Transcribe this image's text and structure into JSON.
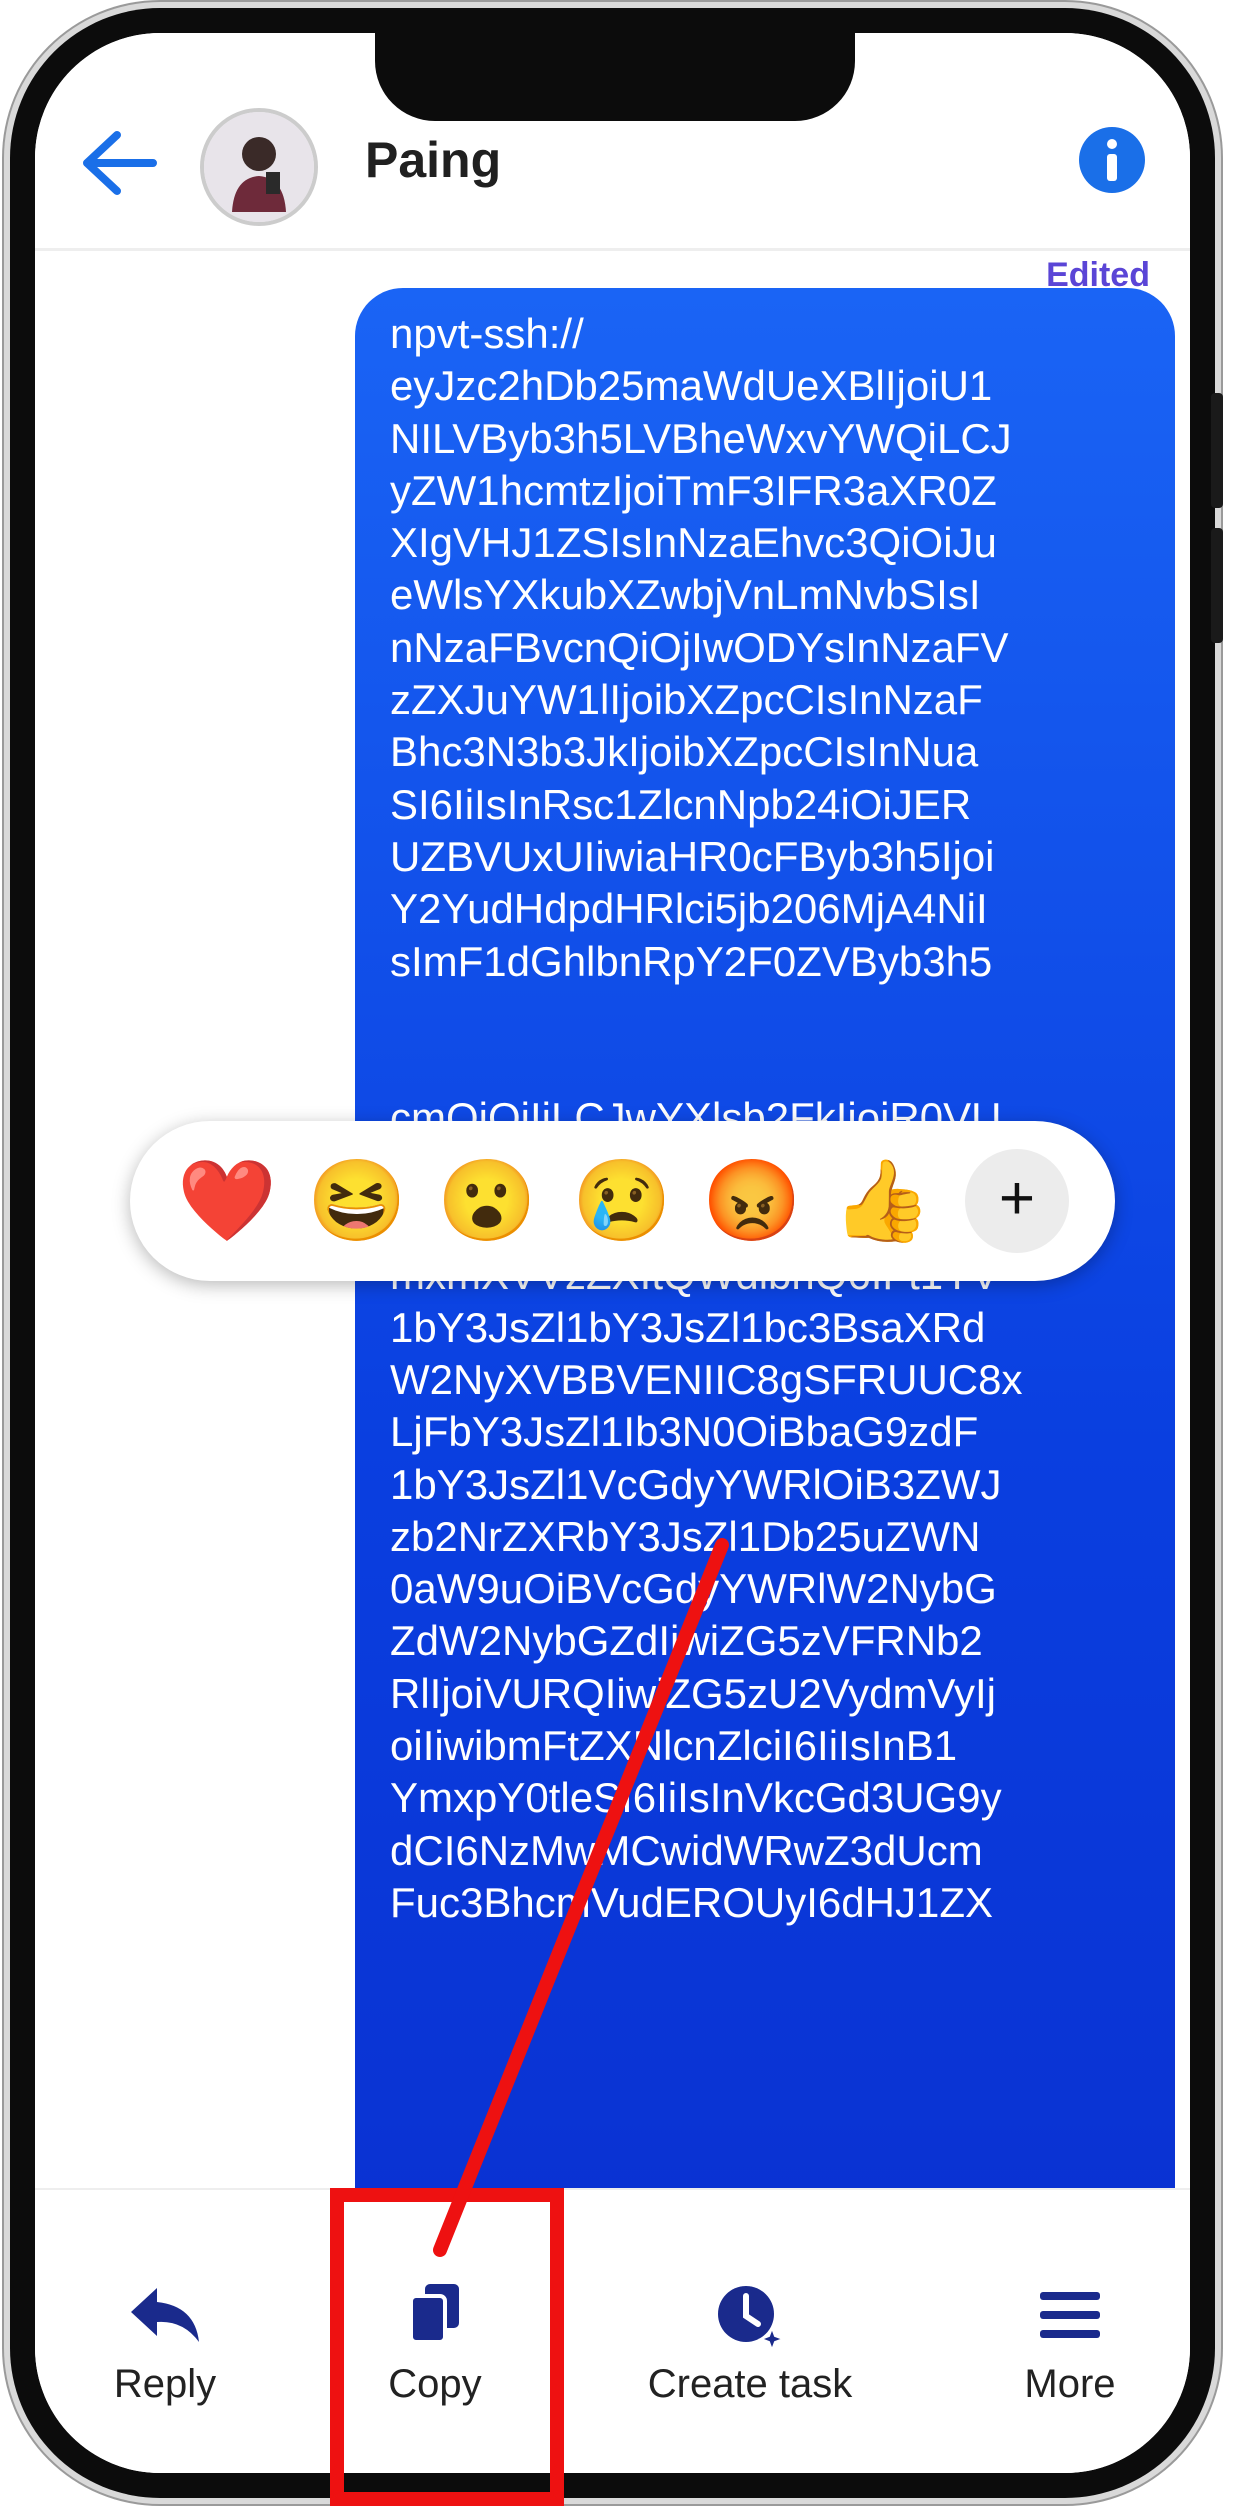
{
  "header": {
    "contact_name": "Paing",
    "back_icon": "back-arrow-icon",
    "info_icon": "info-icon"
  },
  "message": {
    "status": "Edited",
    "text": "npvt-ssh://\neyJzc2hDb25maWdUeXBlIjoiU1\nNILVByb3h5LVBheWxvYWQiLCJ\nyZW1hcmtzIjoiTmF3IFR3aXR0Z\nXIgVHJ1ZSIsInNzaEhvc3QiOiJu\neWlsYXkubXZwbjVnLmNvbSIsI\nnNzaFBvcnQiOjIwODYsInNzaFV\nzZXJuYW1lIjoibXZpcCIsInNzaF\nBhc3N3b3JkIjoibXZpcCIsInNua\nSI6IiIsInRsc1ZlcnNpb24iOiJER\nUZBVUxUIiwiaHR0cFByb3h5Ijoi\nY2YudHdpdHRlci5jb206MjA4NiI\nsImF1dGhlbnRpY2F0ZVByb3h5\n\n\ncmQiOiIiLCJwYXlsb2FkIjoiR0VU\nIC8gSFRUUC8xLjFbY3JsZl1Ib3\nN0OiBjZi50d2l0dGVyLmNvbVtjc\nmxmXVVzZXItQWdlbnQ6IFt1YV\n1bY3JsZl1bY3JsZl1bc3BsaXRd\nW2NyXVBBVENIIC8gSFRUUC8x\nLjFbY3JsZl1Ib3N0OiBbaG9zdF\n1bY3JsZl1VcGdyYWRlOiB3ZWJ\nzb2NrZXRbY3JsZl1Db25uZWN\n0aW9uOiBVcGdyYWRlW2NybG\nZdW2NybGZdIiwiZG5zVFRNb2\nRlIjoiVURQIiwiZG5zU2VydmVyIj\noiIiwibmFtZXNlcnZlciI6IiIsInB1\nYmxpY0tleSI6IiIsInVkcGd3UG9y\ndCI6NzMwMCwidWRwZ3dUcm\nFuc3BhcmVudEROUyI6dHJ1ZX"
  },
  "reactions": [
    {
      "emoji": "❤️",
      "name": "heart-emoji"
    },
    {
      "emoji": "😆",
      "name": "laughing-emoji"
    },
    {
      "emoji": "😮",
      "name": "surprised-emoji"
    },
    {
      "emoji": "😢",
      "name": "sad-emoji"
    },
    {
      "emoji": "😡",
      "name": "angry-emoji"
    },
    {
      "emoji": "👍",
      "name": "thumbs-up-emoji"
    }
  ],
  "reaction_more": "+",
  "toolbar": {
    "reply_label": "Reply",
    "copy_label": "Copy",
    "create_task_label": "Create task",
    "more_label": "More"
  },
  "colors": {
    "accent": "#1a6fe8",
    "bubble_top": "#1a64f5",
    "bubble_bottom": "#0a2fcf",
    "toolbar_icon": "#1a2a8c",
    "highlight": "#ee1111"
  }
}
